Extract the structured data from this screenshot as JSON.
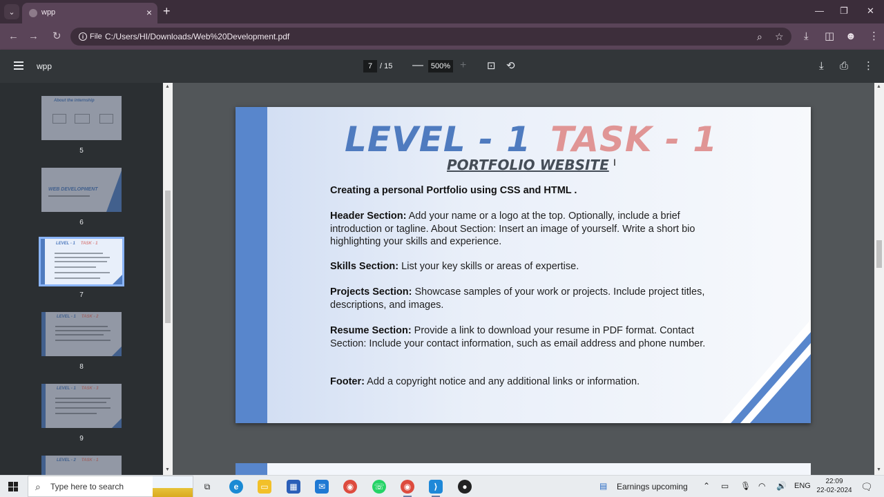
{
  "browser": {
    "tab_title": "wpp",
    "url_scheme_label": "File",
    "url": "C:/Users/HI/Downloads/Web%20Development.pdf"
  },
  "pdf_toolbar": {
    "doc_title": "wpp",
    "current_page": "7",
    "total_pages": "/ 15",
    "zoom": "500%"
  },
  "thumbnails": [
    {
      "label": "5",
      "title": "About the internship"
    },
    {
      "label": "6",
      "title": "WEB DEVELOPMENT"
    },
    {
      "label": "7",
      "title_blue": "LEVEL - 1",
      "title_red": "TASK - 1"
    },
    {
      "label": "8",
      "title_blue": "LEVEL - 1",
      "title_red": "TASK - 2"
    },
    {
      "label": "9",
      "title_blue": "LEVEL - 1",
      "title_red": "TASK - 3"
    },
    {
      "title_blue": "LEVEL - 2",
      "title_red": "TASK - 1"
    }
  ],
  "page": {
    "heading_level": "LEVEL - 1",
    "heading_task": "TASK - 1",
    "subtitle": "PORTFOLIO WEBSITE",
    "intro": "Creating a personal Portfolio using CSS and HTML .",
    "sections": [
      {
        "label": "Header Section:",
        "text": " Add your name or a logo at the top. Optionally, include a brief introduction or tagline. About Section: Insert an image of yourself. Write a short bio highlighting your skills and experience."
      },
      {
        "label": "Skills Section:",
        "text": " List your key skills or areas of expertise."
      },
      {
        "label": "Projects Section:",
        "text": " Showcase samples of your work or projects. Include project titles, descriptions, and images."
      },
      {
        "label": "Resume Section:",
        "text": " Provide a link to download your resume in PDF format. Contact Section: Include your contact information, such as email address and phone number."
      },
      {
        "label": "Footer:",
        "text": " Add a copyright notice and any additional links or information."
      }
    ]
  },
  "taskbar": {
    "search_placeholder": "Type here to search",
    "news": "Earnings upcoming",
    "language": "ENG",
    "time": "22:09",
    "date": "22-02-2024"
  },
  "colors": {
    "slide_blue": "#5886cc",
    "slide_red": "#e09595",
    "chrome_frame": "#3b2d3a",
    "pdf_toolbar": "#323639"
  }
}
